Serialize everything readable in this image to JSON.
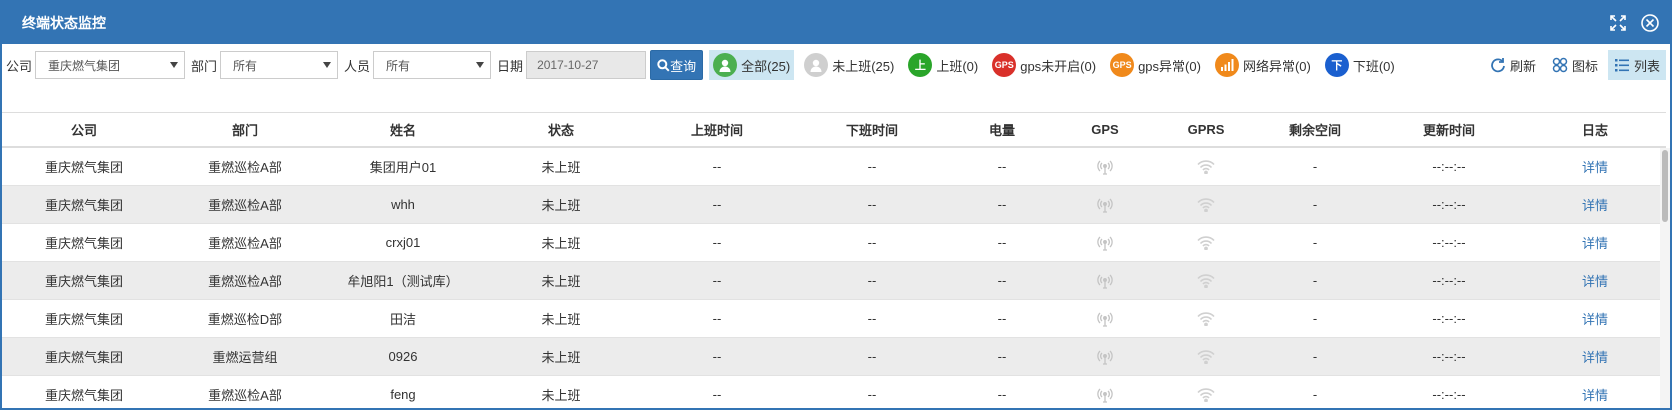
{
  "window": {
    "title": "终端状态监控"
  },
  "filters": {
    "company_label": "公司",
    "company_value": "重庆燃气集团",
    "dept_label": "部门",
    "dept_value": "所有",
    "person_label": "人员",
    "person_value": "所有",
    "date_label": "日期",
    "date_value": "2017-10-27",
    "query_label": "查询"
  },
  "status_chips": [
    {
      "label": "全部(25)",
      "icon_text": "",
      "color": "#4caf50"
    },
    {
      "label": "未上班(25)",
      "icon_text": "",
      "color": "#cfcfcf"
    },
    {
      "label": "上班(0)",
      "icon_text": "上",
      "color": "#2aa52a"
    },
    {
      "label": "gps未开启(0)",
      "icon_text": "GPS",
      "color": "#d9302a"
    },
    {
      "label": "gps异常(0)",
      "icon_text": "GPS",
      "color": "#f0891b"
    },
    {
      "label": "网络异常(0)",
      "icon_text": "",
      "color": "#f0891b"
    },
    {
      "label": "下班(0)",
      "icon_text": "下",
      "color": "#1a5fcf"
    }
  ],
  "tools": {
    "refresh": "刷新",
    "chart": "图标",
    "list": "列表"
  },
  "table": {
    "headers": [
      "公司",
      "部门",
      "姓名",
      "状态",
      "上班时间",
      "下班时间",
      "电量",
      "GPS",
      "GPRS",
      "剩余空间",
      "更新时间",
      "日志"
    ],
    "rows": [
      [
        "重庆燃气集团",
        "重燃巡检A部",
        "集团用户01",
        "未上班",
        "--",
        "--",
        "--",
        "-",
        "--:--:--",
        "详情"
      ],
      [
        "重庆燃气集团",
        "重燃巡检A部",
        "whh",
        "未上班",
        "--",
        "--",
        "--",
        "-",
        "--:--:--",
        "详情"
      ],
      [
        "重庆燃气集团",
        "重燃巡检A部",
        "crxj01",
        "未上班",
        "--",
        "--",
        "--",
        "-",
        "--:--:--",
        "详情"
      ],
      [
        "重庆燃气集团",
        "重燃巡检A部",
        "牟旭阳1（测试库）",
        "未上班",
        "--",
        "--",
        "--",
        "-",
        "--:--:--",
        "详情"
      ],
      [
        "重庆燃气集团",
        "重燃巡检D部",
        "田洁",
        "未上班",
        "--",
        "--",
        "--",
        "-",
        "--:--:--",
        "详情"
      ],
      [
        "重庆燃气集团",
        "重燃运营组",
        "0926",
        "未上班",
        "--",
        "--",
        "--",
        "-",
        "--:--:--",
        "详情"
      ],
      [
        "重庆燃气集团",
        "重燃巡检A部",
        "feng",
        "未上班",
        "--",
        "--",
        "--",
        "-",
        "--:--:--",
        "详情"
      ]
    ]
  }
}
